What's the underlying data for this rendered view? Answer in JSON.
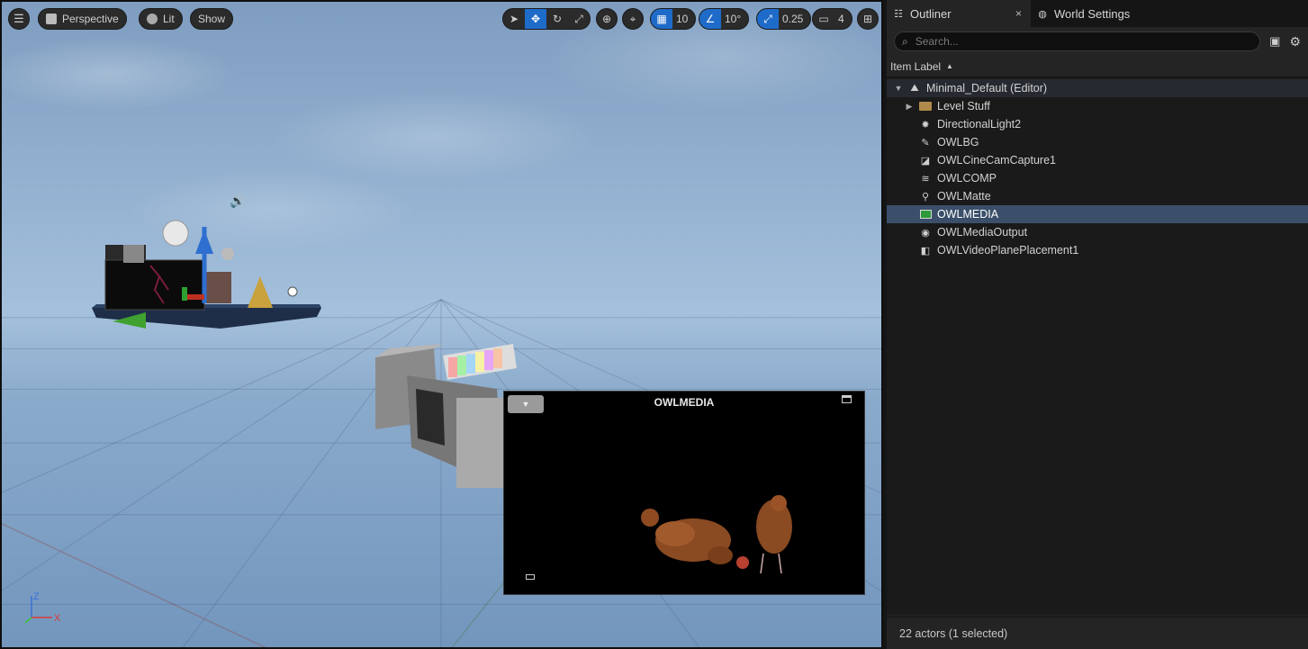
{
  "viewport": {
    "menu_icon": "hamburger-icon",
    "perspective_label": "Perspective",
    "lit_label": "Lit",
    "show_label": "Show",
    "grid_snap_value": "10",
    "rotation_snap_value": "10°",
    "scale_snap_value": "0.25",
    "camera_speed_value": "4",
    "axis_labels": {
      "z": "Z",
      "x": "X"
    }
  },
  "media_panel": {
    "title": "OWLMEDIA"
  },
  "outliner": {
    "tabs": [
      {
        "label": "Outliner",
        "icon": "outliner-icon",
        "close": "×"
      },
      {
        "label": "World Settings",
        "icon": "globe-icon"
      }
    ],
    "search": {
      "placeholder": "Search..."
    },
    "column_header": "Item Label",
    "root": {
      "label": "Minimal_Default (Editor)",
      "icon": "level-icon"
    },
    "items": [
      {
        "label": "Level Stuff",
        "icon": "folder-icon"
      },
      {
        "label": "DirectionalLight2",
        "icon": "sun-icon"
      },
      {
        "label": "OWLBG",
        "icon": "actor-icon"
      },
      {
        "label": "OWLCineCamCapture1",
        "icon": "camera-icon"
      },
      {
        "label": "OWLCOMP",
        "icon": "layers-icon"
      },
      {
        "label": "OWLMatte",
        "icon": "satellite-icon"
      },
      {
        "label": "OWLMEDIA",
        "icon": "film-icon"
      },
      {
        "label": "OWLMediaOutput",
        "icon": "output-icon"
      },
      {
        "label": "OWLVideoPlanePlacement1",
        "icon": "cube-icon"
      }
    ],
    "status": "22 actors (1 selected)"
  },
  "colors": {
    "accent": "#1f6bc9",
    "selection": "#3b4f6a",
    "panel_bg": "#1f1f1f"
  }
}
